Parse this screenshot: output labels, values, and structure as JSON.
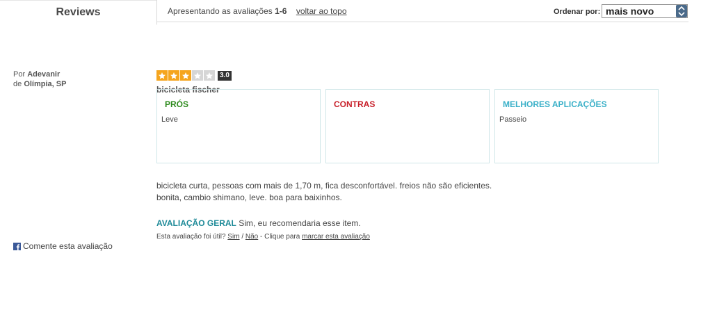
{
  "tab": {
    "label": "Reviews"
  },
  "toolbar": {
    "showing_prefix": "Apresentando as avaliações",
    "showing_range": "1-6",
    "back_to_top": "voltar ao topo",
    "sort_label": "Ordenar por:",
    "sort_value": "mais novo"
  },
  "review": {
    "author_prefix": "Por",
    "author_name": "Adevanir",
    "location_prefix": "de",
    "location": "Olímpia, SP",
    "rating": 3,
    "rating_max": 5,
    "rating_label": "3.0",
    "title": "bicicleta fischer",
    "pros": {
      "title": "PRÓS",
      "text": "Leve",
      "color": "#2e8b1e"
    },
    "cons": {
      "title": "CONTRAS",
      "text": "",
      "color": "#c8202a"
    },
    "best_uses": {
      "title": "MELHORES APLICAÇÕES",
      "text": "Passeio",
      "color": "#3ab0c8"
    },
    "body_line1": "bicicleta curta, pessoas com mais de 1,70 m, fica desconfortável. freios não são eficientes.",
    "body_line2": "bonita, cambio shimano, leve. boa para baixinhos.",
    "overall_label": "AVALIAÇÃO GERAL",
    "overall_text": "Sim, eu recomendaria esse item.",
    "helpful_prefix": "Esta avaliação foi útil?",
    "helpful_yes": "Sim",
    "helpful_sep": "/",
    "helpful_no": "Não",
    "helpful_mid": "- Clique para",
    "helpful_report": "marcar esta avaliação"
  },
  "comment": {
    "icon": "facebook-icon",
    "label": "Comente esta avaliação"
  }
}
